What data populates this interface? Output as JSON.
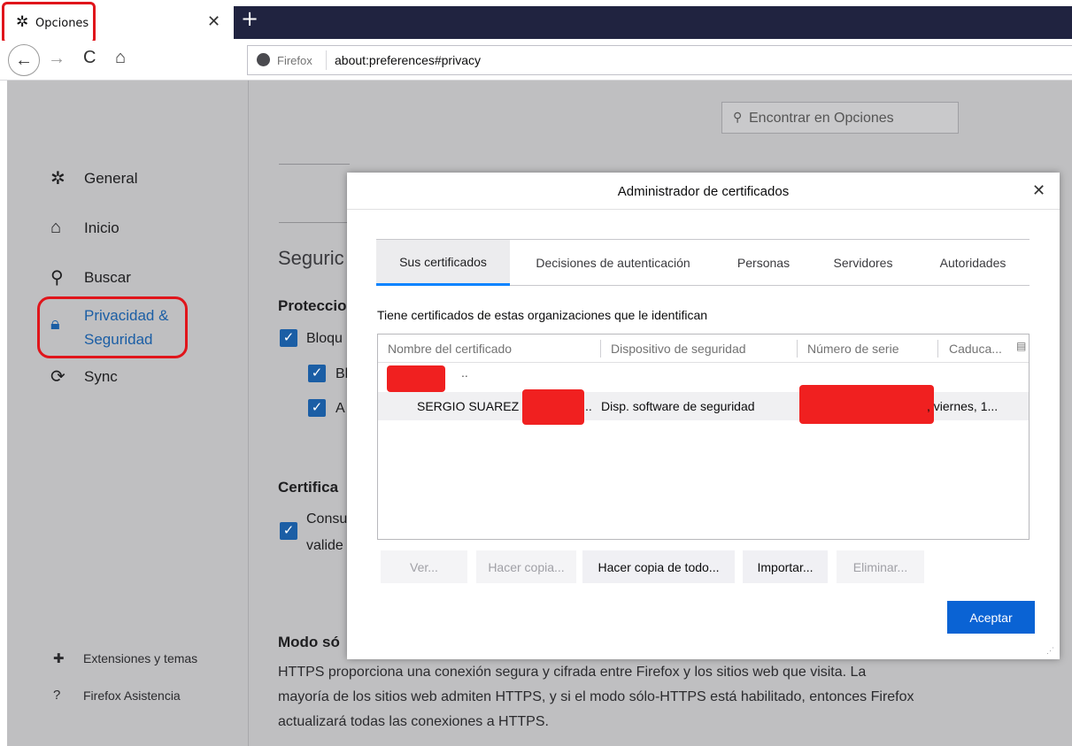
{
  "tab": {
    "title": "Opciones",
    "close_glyph": "✕",
    "new_tab_glyph": "+"
  },
  "nav": {
    "back_glyph": "←",
    "forward_glyph": "→",
    "reload_glyph": "C",
    "home_glyph": "⌂",
    "identity_label": "Firefox",
    "url": "about:preferences#privacy"
  },
  "search": {
    "placeholder": "Encontrar en Opciones"
  },
  "sidebar": {
    "items": [
      {
        "label": "General",
        "icon": "gear-icon"
      },
      {
        "label": "Inicio",
        "icon": "home-icon"
      },
      {
        "label": "Buscar",
        "icon": "search-icon"
      },
      {
        "label_line1": "Privacidad &",
        "label_line2": "Seguridad",
        "icon": "lock-icon"
      },
      {
        "label": "Sync",
        "icon": "sync-icon"
      }
    ],
    "footer": [
      {
        "label": "Extensiones y temas",
        "icon": "puzzle-icon"
      },
      {
        "label": "Firefox Asistencia",
        "icon": "help-icon"
      }
    ]
  },
  "main": {
    "section_title": "Seguric",
    "protection_heading": "Proteccio",
    "protection_checks": [
      "Bloqu",
      "Bl",
      "A"
    ],
    "cert_heading": "Certifica",
    "cert_check_line1": "Consu",
    "cert_check_line2": "valide",
    "https_heading": "Modo só",
    "https_text_1": "HTTPS proporciona una conexión segura y cifrada entre Firefox y los sitios web que visita. La",
    "https_text_2": "mayoría de los sitios web admiten HTTPS, y si el modo sólo-HTTPS está habilitado, entonces Firefox",
    "https_text_3": "actualizará todas las conexiones a HTTPS."
  },
  "dialog": {
    "title": "Administrador de certificados",
    "close_glyph": "✕",
    "tabs": [
      "Sus certificados",
      "Decisiones de autenticación",
      "Personas",
      "Servidores",
      "Autoridades"
    ],
    "description": "Tiene certificados de estas organizaciones que le identifican",
    "columns": [
      "Nombre del certificado",
      "Dispositivo de seguridad",
      "Número de serie",
      "Caduca..."
    ],
    "rows": [
      {
        "name": "",
        "device": "",
        "serial": "",
        "expires": ""
      },
      {
        "name": "SERGIO SUAREZ N",
        "name_tail": "l...",
        "device": "Disp. software de seguridad",
        "serial": "",
        "expires": ", viernes, 1..."
      }
    ],
    "buttons": {
      "view": "Ver...",
      "backup": "Hacer copia...",
      "backup_all": "Hacer copia de todo...",
      "import": "Importar...",
      "delete": "Eliminar...",
      "accept": "Aceptar"
    }
  },
  "colors": {
    "accent": "#0a63d4",
    "selected_tab_underline": "#0a84ff",
    "highlight": "#e0151b",
    "tabbar_dark": "#202340"
  }
}
